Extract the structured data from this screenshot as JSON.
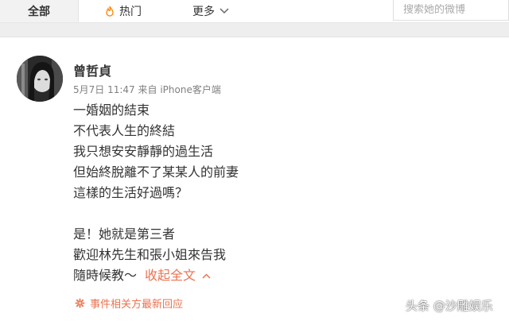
{
  "nav": {
    "tabs": [
      {
        "label": "全部",
        "active": true
      },
      {
        "label": "热门",
        "icon": "fire-icon"
      },
      {
        "label": "更多",
        "icon": "chevron-down-icon"
      }
    ],
    "search": {
      "placeholder": "搜索她的微博"
    }
  },
  "post": {
    "author": "曾哲貞",
    "date": "5月7日 11:47",
    "source_prefix": "来自",
    "source": "iPhone客户端",
    "lines": [
      "一婚姻的結束",
      "不代表人生的終結",
      "我只想安安靜靜的過生活",
      "但始終脫離不了某某人的前妻",
      "這樣的生活好過嗎？",
      "",
      "是！她就是第三者",
      "歡迎林先生和張小姐來告我",
      "隨時候教～"
    ],
    "collapse_label": "收起全文",
    "related_label": "事件相关方最新回应"
  },
  "watermark": "头条 @沙雕娱乐",
  "colors": {
    "accent": "#eb7350",
    "text": "#333333",
    "meta": "#808080"
  }
}
